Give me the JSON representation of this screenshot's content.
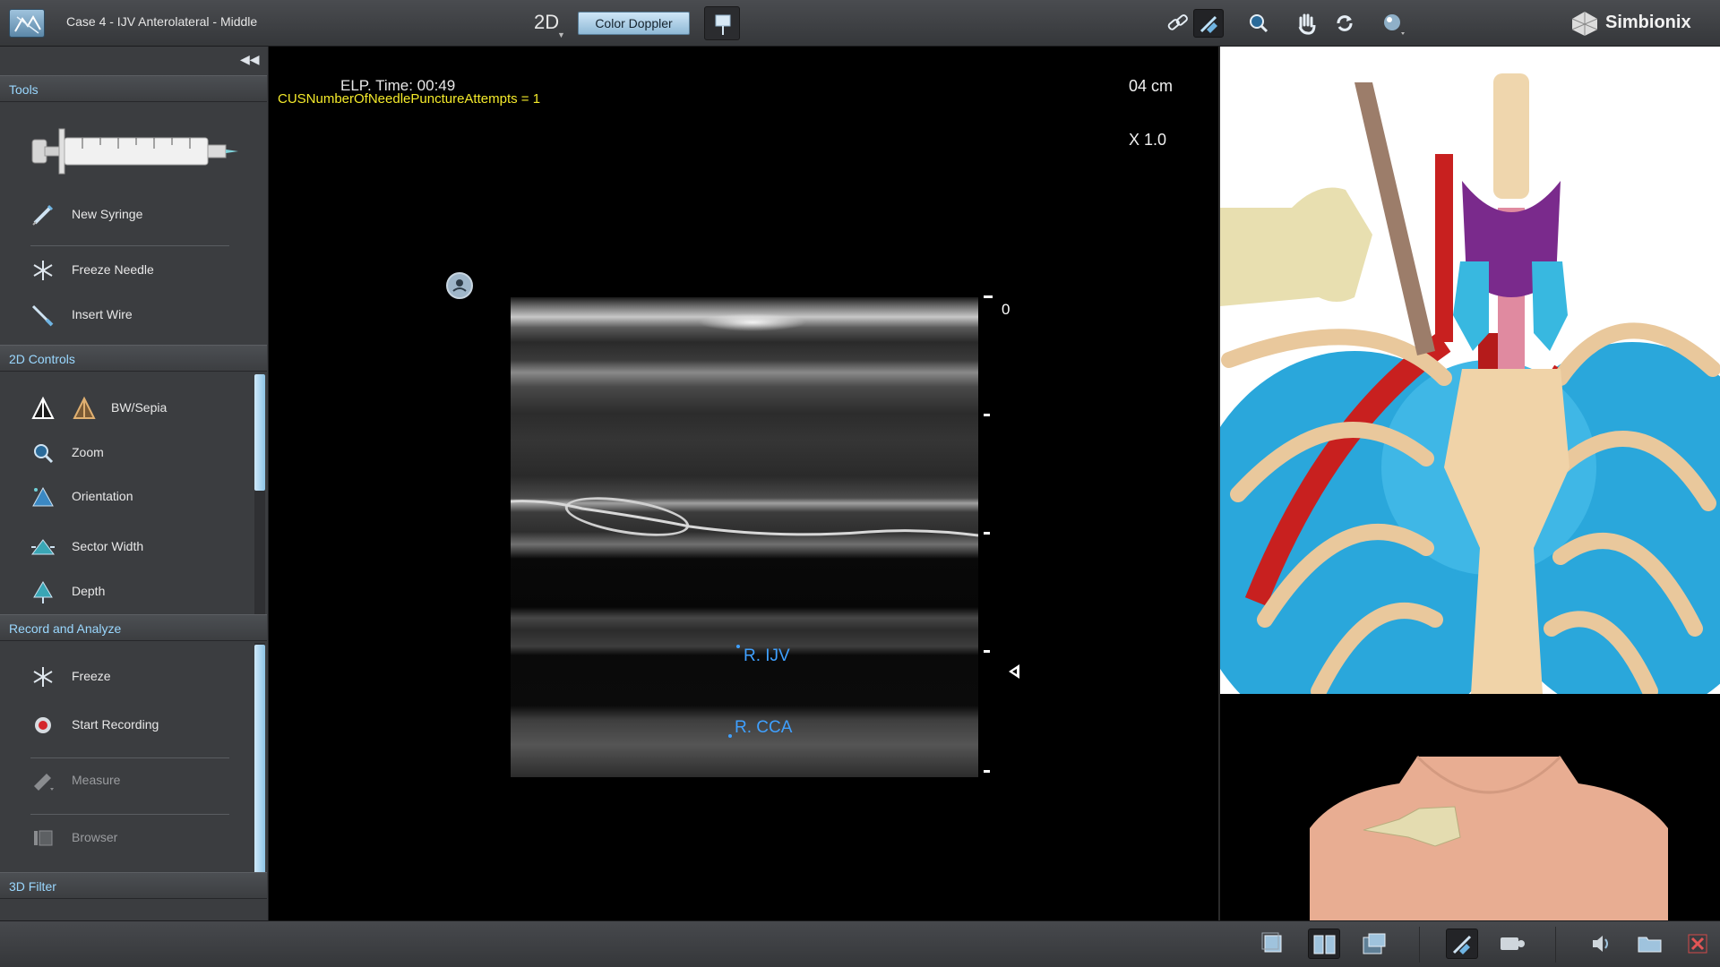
{
  "header": {
    "case_title": "Case 4 - IJV Anterolateral - Middle",
    "mode": "2D",
    "doppler_button": "Color Doppler",
    "toolbar_icons": [
      "link-icon",
      "needle-guide-icon",
      "zoom-magnifier-icon",
      "hand-pan-icon",
      "rotate-icon",
      "lighting-sphere-icon"
    ],
    "brand": "Simbionix"
  },
  "left_panel": {
    "tools": {
      "title": "Tools",
      "items": [
        {
          "label": "New Syringe",
          "icon": "syringe-icon"
        },
        {
          "label": "Freeze Needle",
          "icon": "snowflake-icon"
        },
        {
          "label": "Insert Wire",
          "icon": "wire-icon"
        }
      ]
    },
    "controls_2d": {
      "title": "2D Controls",
      "items": [
        {
          "label": "BW/Sepia",
          "icon": "bw-sepia-icon"
        },
        {
          "label": "Zoom",
          "icon": "zoom-icon"
        },
        {
          "label": "Orientation",
          "icon": "orientation-icon"
        },
        {
          "label": "Sector Width",
          "icon": "sector-width-icon"
        },
        {
          "label": "Depth",
          "icon": "depth-icon"
        }
      ]
    },
    "record": {
      "title": "Record and Analyze",
      "items": [
        {
          "label": "Freeze",
          "icon": "snowflake-icon"
        },
        {
          "label": "Start Recording",
          "icon": "record-icon"
        },
        {
          "label": "Measure",
          "icon": "ruler-icon"
        },
        {
          "label": "Browser",
          "icon": "browser-icon"
        }
      ]
    },
    "filter_3d": {
      "title": "3D Filter"
    }
  },
  "ultrasound": {
    "elp_time": "ELP. Time: 00:49",
    "attempts": "CUSNumberOfNeedlePunctureAttempts = 1",
    "depth": "04 cm",
    "zoom": "X 1.0",
    "scale_zero": "0",
    "labels": {
      "ijv": "R. IJV",
      "cca": "R. CCA"
    }
  },
  "bottom_toolbar": {
    "icons": [
      "single-view-icon",
      "dual-view-icon",
      "overlay-view-icon",
      "needle-tool-icon",
      "camera-icon",
      "speaker-icon",
      "folder-icon",
      "close-icon"
    ]
  },
  "colors": {
    "header_accent": "#9ad8ff",
    "vessel_label": "#3fa0ff",
    "attempts_text": "#f4ea2b",
    "doppler_button": "#b5d6ee"
  }
}
